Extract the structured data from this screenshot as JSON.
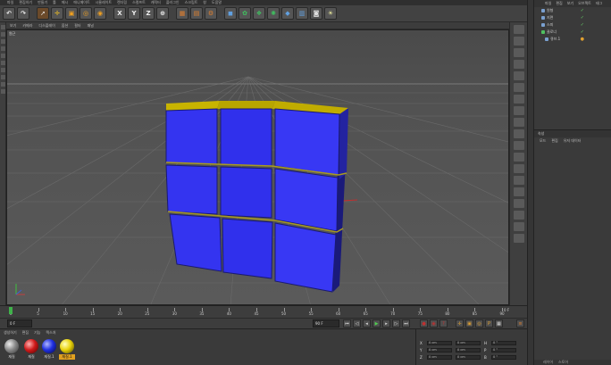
{
  "menubar": {
    "items": [
      "파일",
      "편집하기",
      "만들기",
      "툴",
      "메시",
      "애니메이트",
      "시뮬레이트",
      "렌더링",
      "스컬프트",
      "캐릭터",
      "플러그인",
      "스크립트",
      "창",
      "도움말"
    ]
  },
  "toolbar": {
    "x_label": "X",
    "y_label": "Y",
    "z_label": "Z"
  },
  "viewport": {
    "menu": [
      "보기",
      "카메라",
      "디스플레이",
      "옵션",
      "필터",
      "패널"
    ],
    "label": "원근"
  },
  "object_manager": {
    "menu": [
      "파일",
      "편집",
      "보기",
      "오브젝트",
      "태그"
    ],
    "objects": [
      {
        "name": "원형"
      },
      {
        "name": "지면"
      },
      {
        "name": "스피"
      },
      {
        "name": "클로너"
      },
      {
        "name": "큐브.1"
      }
    ]
  },
  "attribute_manager": {
    "title": "속성",
    "menu": [
      "모드",
      "편집",
      "유저 데이터"
    ],
    "bottom_tabs": [
      "레이어",
      "스토어"
    ]
  },
  "timeline": {
    "ticks": [
      "0",
      "5",
      "10",
      "15",
      "20",
      "25",
      "30",
      "35",
      "40",
      "45",
      "50",
      "55",
      "60",
      "65",
      "70",
      "75",
      "80",
      "85",
      "90"
    ],
    "end_label": "0 F"
  },
  "transport": {
    "current_frame": "0 F",
    "end_frame": "90 F"
  },
  "material_manager": {
    "menu": [
      "생성하기",
      "편집",
      "기능",
      "텍스처"
    ],
    "materials": [
      {
        "label": "재질",
        "color": "#8a8a8a"
      },
      {
        "label": "재질",
        "color": "#d01a1a"
      },
      {
        "label": "재질.1",
        "color": "#1f2fe0"
      },
      {
        "label": "재질.1",
        "color": "#e8d20a"
      }
    ]
  },
  "coordinates": {
    "rows": [
      {
        "axis": "X",
        "pos": "0 cm",
        "size": "0 cm",
        "rot_axis": "H",
        "rot": "0 °"
      },
      {
        "axis": "Y",
        "pos": "0 cm",
        "size": "0 cm",
        "rot_axis": "P",
        "rot": "0 °"
      },
      {
        "axis": "Z",
        "pos": "0 cm",
        "size": "0 cm",
        "rot_axis": "B",
        "rot": "0 °"
      }
    ]
  },
  "colors": {
    "cube_face": "#3333f0",
    "cube_top": "#c8b400",
    "background": "#4e4e4e"
  }
}
